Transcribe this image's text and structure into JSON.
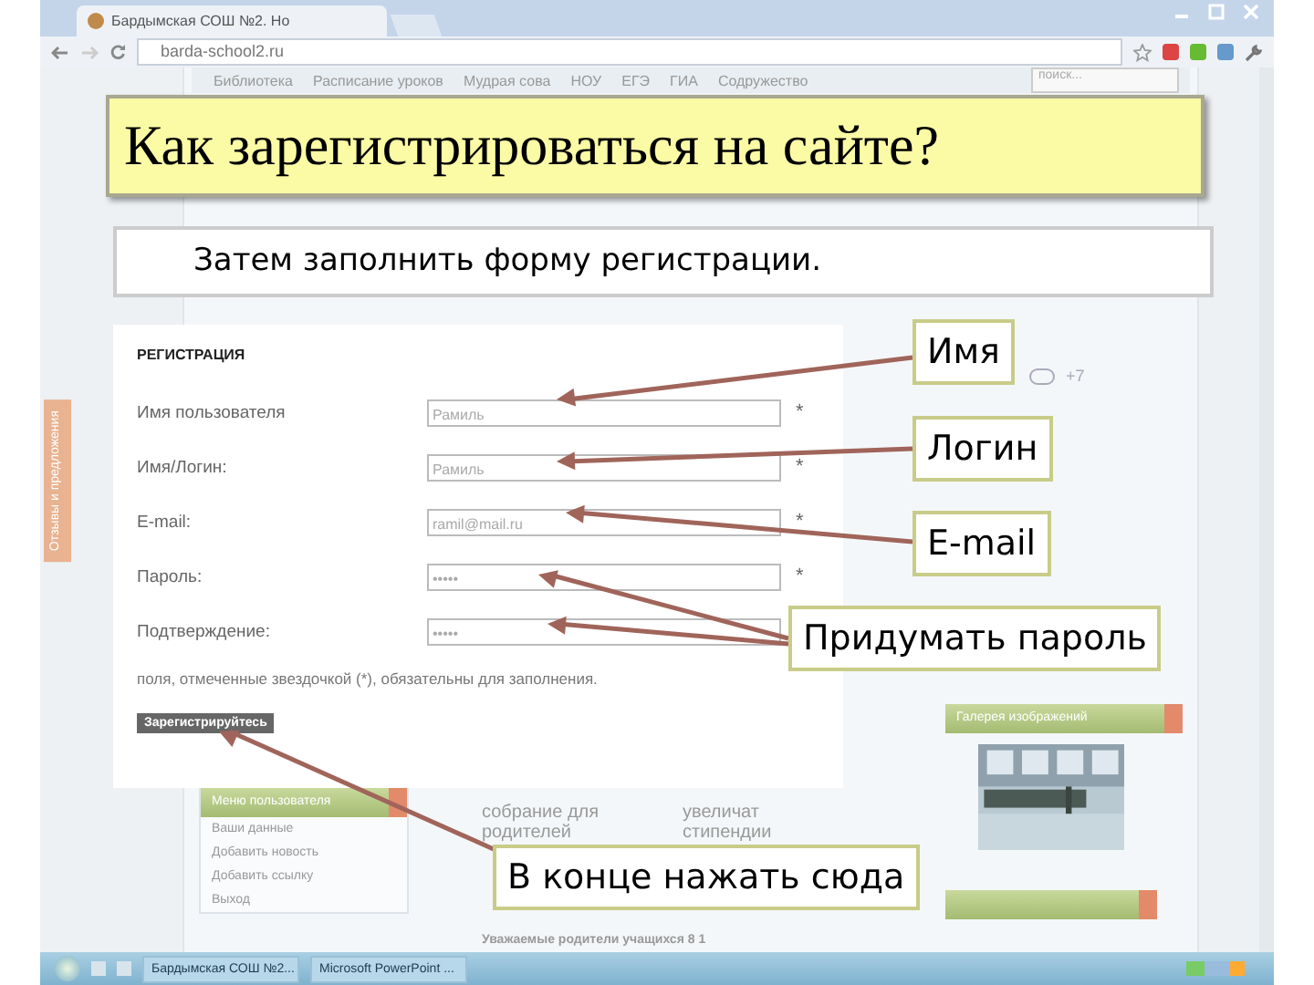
{
  "browser": {
    "tab_title": "Бардымская СОШ №2. Но",
    "address": "barda-school2.ru"
  },
  "site": {
    "nav": [
      "Библиотека",
      "Расписание уроков",
      "Мудрая сова",
      "НОУ",
      "ЕГЭ",
      "ГИА",
      "Содружество"
    ],
    "search": {
      "placeholder": "поиск..."
    },
    "side_tab": "Отзывы и предложения",
    "counter": "+7",
    "gallery_title": "Галерея изображений",
    "user_menu": {
      "title": "Меню пользователя",
      "items": [
        "Ваши данные",
        "Добавить новость",
        "Добавить ссылку",
        "Выход"
      ]
    },
    "news": [
      "собрание для родителей",
      "увеличат стипендии"
    ],
    "bottom_news": "Уважаемые родители учащихся 8 1"
  },
  "slide": {
    "title": "Как зарегистрироваться на сайте?",
    "subtitle": "Затем заполнить форму регистрации.",
    "callouts": [
      {
        "text": "Имя"
      },
      {
        "text": "Логин"
      },
      {
        "text": "E-mail"
      },
      {
        "text": "Придумать пароль"
      },
      {
        "text": "В конце нажать сюда"
      }
    ]
  },
  "form": {
    "heading": "РЕГИСТРАЦИЯ",
    "fields": [
      {
        "label": "Имя пользователя",
        "value": "Рамиль",
        "mark": "*"
      },
      {
        "label": "Имя/Логин:",
        "value": "Рамиль",
        "mark": "*"
      },
      {
        "label": "E-mail:",
        "value": "ramil@mail.ru",
        "mark": "*"
      },
      {
        "label": "Пароль:",
        "value": "•••••",
        "mark": "*"
      },
      {
        "label": "Подтверждение:",
        "value": "•••••"
      }
    ],
    "note": "поля, отмеченные звездочкой (*), обязательны для заполнения.",
    "submit": "Зарегистрируйтесь"
  },
  "taskbar": {
    "tasks": [
      "Бардымская СОШ №2...",
      "Microsoft PowerPoint ..."
    ]
  }
}
